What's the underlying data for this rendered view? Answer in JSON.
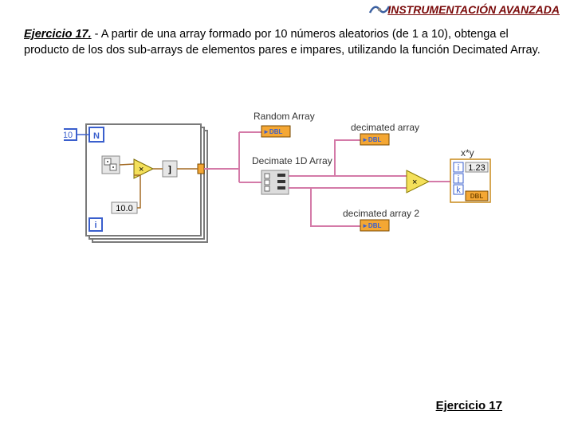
{
  "header": {
    "title": "INSTRUMENTACIÓN AVANZADA"
  },
  "exercise": {
    "label": "Ejercicio 17.",
    "text": " - A partir de una array formado por 10 números aleatorios (de 1 a 10), obtenga el producto de los dos sub-arrays de elementos pares e impares, utilizando la función Decimated Array."
  },
  "footer": {
    "link": "Ejercicio 17"
  },
  "diagram": {
    "loop_count": "10",
    "loop_N": "N",
    "loop_i": "i",
    "const_ten": "10.0",
    "labels": {
      "random_array": "Random Array",
      "decimate": "Decimate 1D Array",
      "dec_arr": "decimated array",
      "dec_arr2": "decimated array 2",
      "xy": "x*y",
      "dbl": "DBL"
    },
    "array_box_glyph": "►DBL",
    "xy_letters": {
      "i": "i",
      "j": "j",
      "k": "k"
    },
    "num_placeholder": "1.23"
  }
}
